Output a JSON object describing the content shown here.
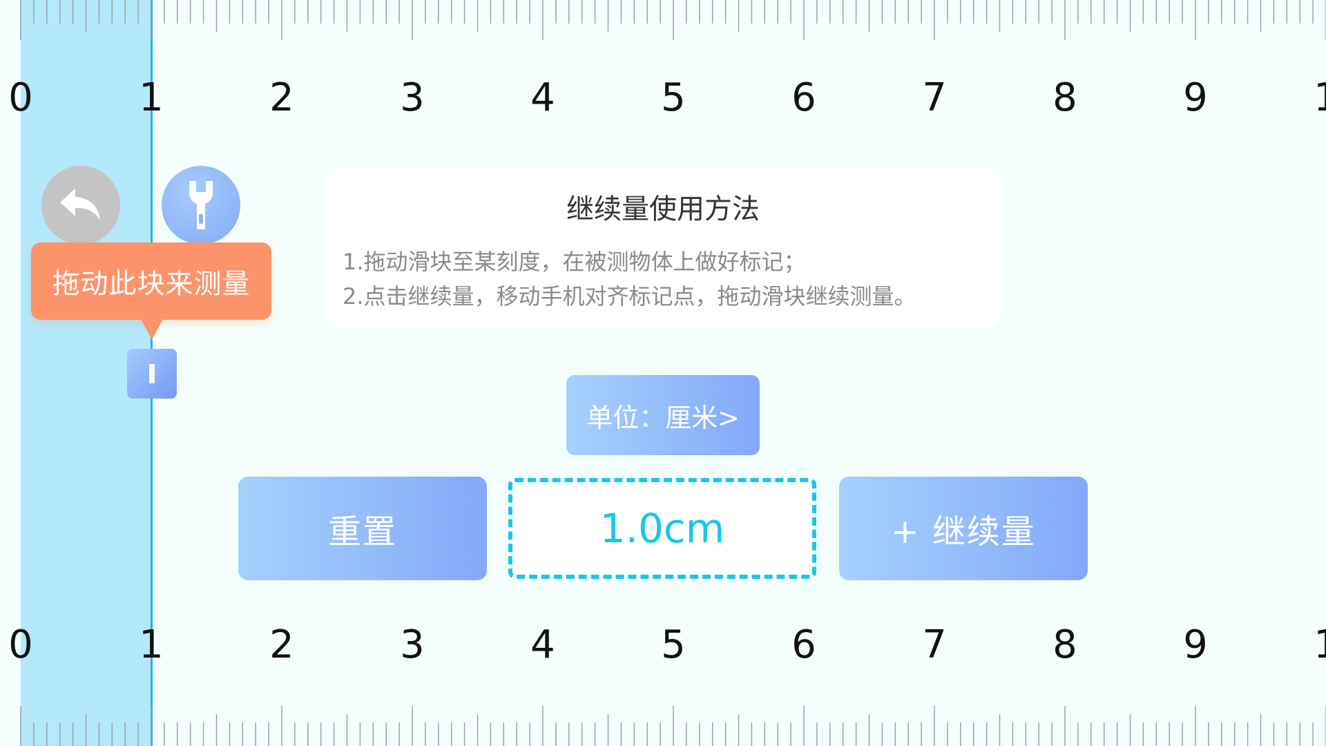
{
  "ruler": {
    "unit_labels": [
      "0",
      "1",
      "2",
      "3",
      "4",
      "5",
      "6",
      "7",
      "8",
      "9",
      "1"
    ],
    "measured_value": 1.0
  },
  "controls": {
    "back_icon": "back-arrow-icon",
    "tool_icon": "wrench-icon",
    "drag_hint": "拖动此块来测量"
  },
  "instructions": {
    "title": "继续量使用方法",
    "line1": "1.拖动滑块至某刻度，在被测物体上做好标记；",
    "line2": "2.点击继续量，移动手机对齐标记点，拖动滑块继续测量。"
  },
  "unit_button": {
    "label": "单位：厘米>"
  },
  "actions": {
    "reset_label": "重置",
    "reading": "1.0cm",
    "continue_label": "+ 继续量"
  },
  "colors": {
    "accent": "#17c6ec",
    "measure_fill": "#b3e9fb",
    "tooltip": "#fc936a",
    "button_start": "#a6d1fd",
    "button_end": "#84a8f9"
  }
}
